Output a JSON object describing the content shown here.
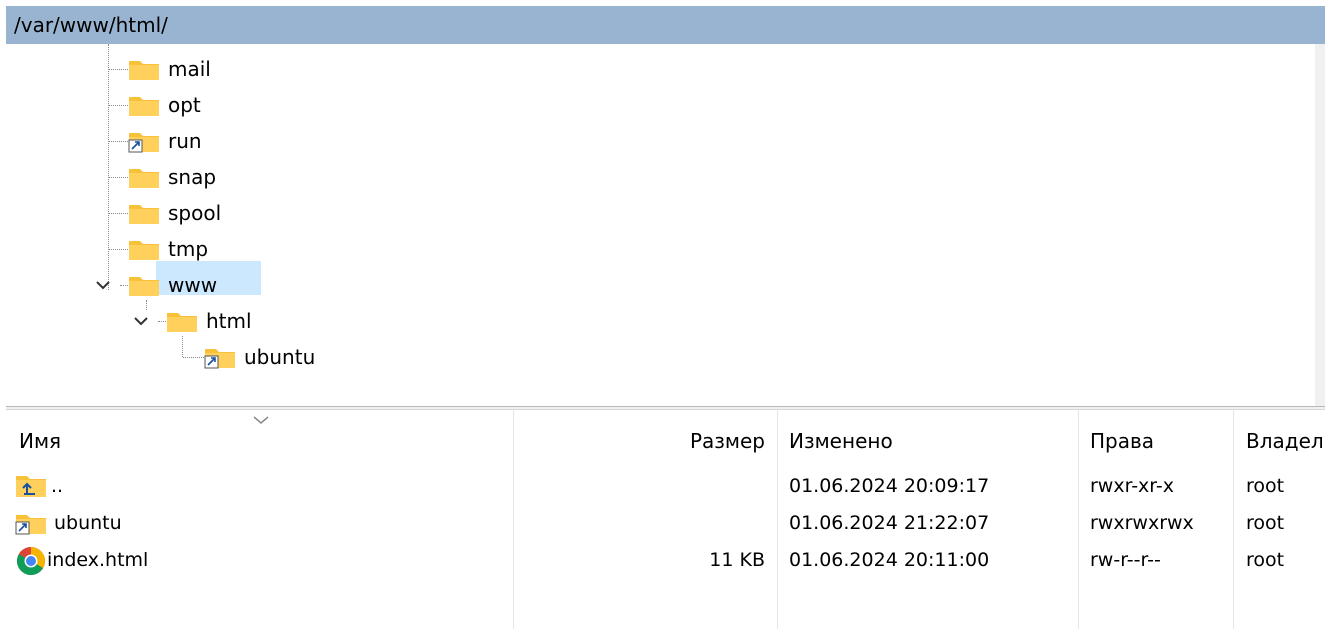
{
  "path_bar": {
    "path": "/var/www/html/"
  },
  "tree": {
    "items": [
      {
        "label": "mail",
        "icon": "folder-icon"
      },
      {
        "label": "opt",
        "icon": "folder-icon"
      },
      {
        "label": "run",
        "icon": "folder-link-icon"
      },
      {
        "label": "snap",
        "icon": "folder-icon"
      },
      {
        "label": "spool",
        "icon": "folder-icon"
      },
      {
        "label": "tmp",
        "icon": "folder-icon"
      },
      {
        "label": "www",
        "icon": "folder-icon",
        "expanded": true
      },
      {
        "label": "html",
        "icon": "folder-icon",
        "expanded": true,
        "selected": true
      },
      {
        "label": "ubuntu",
        "icon": "folder-link-icon"
      }
    ]
  },
  "file_list": {
    "columns": {
      "name": "Имя",
      "size": "Размер",
      "modified": "Изменено",
      "rights": "Права",
      "owner": "Владел"
    },
    "rows": [
      {
        "icon": "parent-folder-icon",
        "name": "..",
        "size": "",
        "modified": "01.06.2024 20:09:17",
        "rights": "rwxr-xr-x",
        "owner": "root"
      },
      {
        "icon": "folder-link-icon",
        "name": "ubuntu",
        "size": "",
        "modified": "01.06.2024 21:22:07",
        "rights": "rwxrwxrwx",
        "owner": "root"
      },
      {
        "icon": "chrome-icon",
        "name": "index.html",
        "size": "11 KB",
        "modified": "01.06.2024 20:11:00",
        "rights": "rw-r--r--",
        "owner": "root"
      }
    ]
  },
  "colors": {
    "path_bar_bg": "#99b4d1",
    "selection_bg": "#cce8ff",
    "folder_yellow": "#ffd15c"
  }
}
